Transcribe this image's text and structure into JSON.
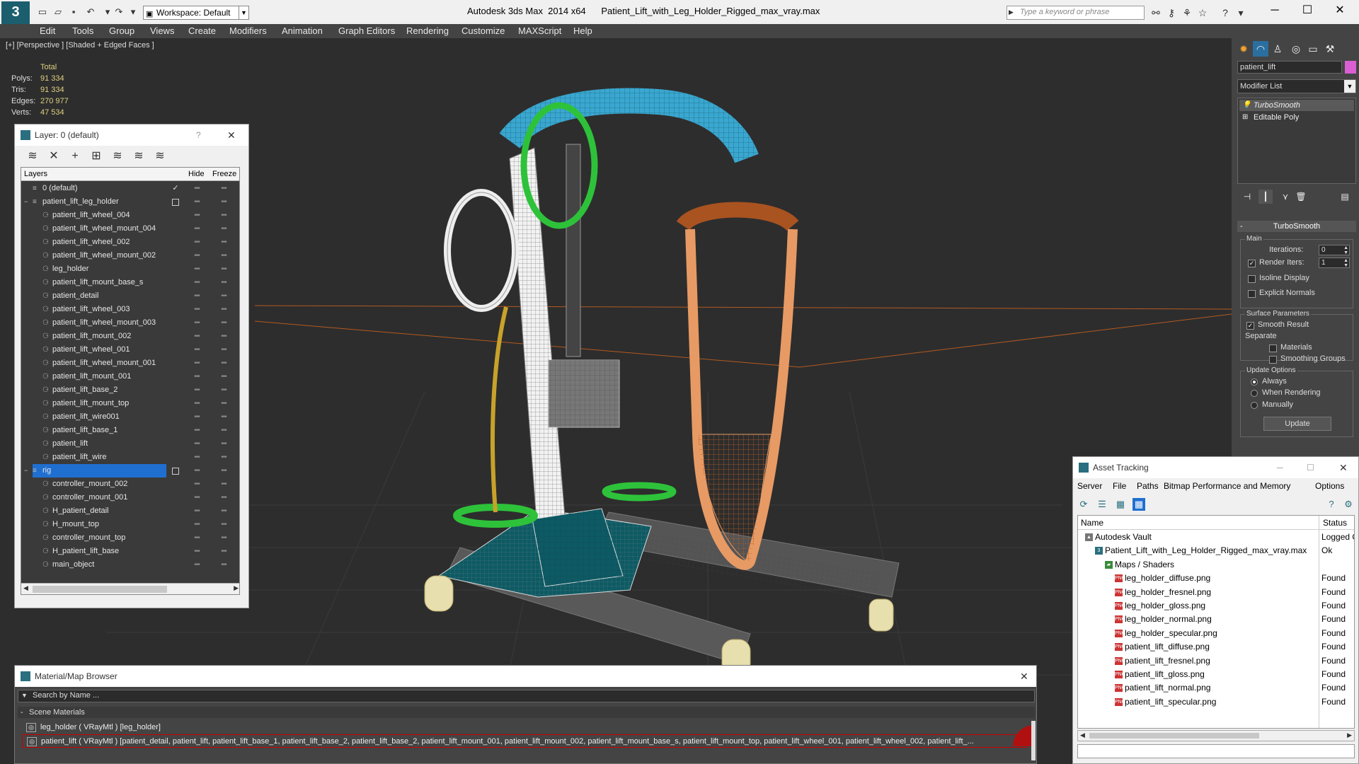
{
  "app": {
    "name_version": "Autodesk 3ds Max  2014 x64",
    "file": "Patient_Lift_with_Leg_Holder_Rigged_max_vray.max",
    "workspace": "Workspace: Default",
    "search_placeholder": "Type a keyword or phrase",
    "logo_letter": "3"
  },
  "menu": [
    "Edit",
    "Tools",
    "Group",
    "Views",
    "Create",
    "Modifiers",
    "Animation",
    "Graph Editors",
    "Rendering",
    "Customize",
    "MAXScript",
    "Help"
  ],
  "viewport": {
    "label": "[+] [Perspective ] [Shaded + Edged Faces ]",
    "stats": {
      "header": "Total",
      "rows": [
        {
          "k": "Polys:",
          "v": "91 334"
        },
        {
          "k": "Tris:",
          "v": "91 334"
        },
        {
          "k": "Edges:",
          "v": "270 977"
        },
        {
          "k": "Verts:",
          "v": "47 534"
        }
      ]
    }
  },
  "layer_panel": {
    "title": "Layer: 0 (default)",
    "help": "?",
    "close": "✕",
    "col_layers": "Layers",
    "col_hide": "Hide",
    "col_freeze": "Freeze",
    "rows": [
      {
        "name": "0 (default)",
        "level": 0,
        "type": "layer",
        "checked": true
      },
      {
        "name": "patient_lift_leg_holder",
        "level": 0,
        "type": "layer",
        "expand": "−",
        "box": true
      },
      {
        "name": "patient_lift_wheel_004",
        "level": 1,
        "type": "obj"
      },
      {
        "name": "patient_lift_wheel_mount_004",
        "level": 1,
        "type": "obj"
      },
      {
        "name": "patient_lift_wheel_002",
        "level": 1,
        "type": "obj"
      },
      {
        "name": "patient_lift_wheel_mount_002",
        "level": 1,
        "type": "obj"
      },
      {
        "name": "leg_holder",
        "level": 1,
        "type": "obj"
      },
      {
        "name": "patient_lift_mount_base_s",
        "level": 1,
        "type": "obj"
      },
      {
        "name": "patient_detail",
        "level": 1,
        "type": "obj"
      },
      {
        "name": "patient_lift_wheel_003",
        "level": 1,
        "type": "obj"
      },
      {
        "name": "patient_lift_wheel_mount_003",
        "level": 1,
        "type": "obj"
      },
      {
        "name": "patient_lift_mount_002",
        "level": 1,
        "type": "obj"
      },
      {
        "name": "patient_lift_wheel_001",
        "level": 1,
        "type": "obj"
      },
      {
        "name": "patient_lift_wheel_mount_001",
        "level": 1,
        "type": "obj"
      },
      {
        "name": "patient_lift_mount_001",
        "level": 1,
        "type": "obj"
      },
      {
        "name": "patient_lift_base_2",
        "level": 1,
        "type": "obj"
      },
      {
        "name": "patient_lift_mount_top",
        "level": 1,
        "type": "obj"
      },
      {
        "name": "patient_lift_wire001",
        "level": 1,
        "type": "obj"
      },
      {
        "name": "patient_lift_base_1",
        "level": 1,
        "type": "obj"
      },
      {
        "name": "patient_lift",
        "level": 1,
        "type": "obj"
      },
      {
        "name": "patient_lift_wire",
        "level": 1,
        "type": "obj"
      },
      {
        "name": "rig",
        "level": 0,
        "type": "layer",
        "expand": "−",
        "box": true,
        "selected": true
      },
      {
        "name": "controller_mount_002",
        "level": 1,
        "type": "obj"
      },
      {
        "name": "controller_mount_001",
        "level": 1,
        "type": "obj"
      },
      {
        "name": "H_patient_detail",
        "level": 1,
        "type": "obj"
      },
      {
        "name": "H_mount_top",
        "level": 1,
        "type": "obj"
      },
      {
        "name": "controller_mount_top",
        "level": 1,
        "type": "obj"
      },
      {
        "name": "H_patient_lift_base",
        "level": 1,
        "type": "obj"
      },
      {
        "name": "main_object",
        "level": 1,
        "type": "obj"
      }
    ]
  },
  "command_panel": {
    "object_name": "patient_lift",
    "object_color": "#d95fd2",
    "modifier_list": "Modifier List",
    "stack": [
      "TurboSmooth",
      "Editable Poly"
    ],
    "turbosmooth": {
      "title": "TurboSmooth",
      "main": "Main",
      "iterations_label": "Iterations:",
      "iterations": "0",
      "render_iters_label": "Render Iters:",
      "render_iters": "1",
      "isoline": "Isoline Display",
      "explicit_normals": "Explicit Normals",
      "surface_params": "Surface Parameters",
      "smooth_result": "Smooth Result",
      "separate": "Separate",
      "materials": "Materials",
      "smoothing_groups": "Smoothing Groups",
      "update_options": "Update Options",
      "always": "Always",
      "when_rendering": "When Rendering",
      "manually": "Manually",
      "update_btn": "Update"
    }
  },
  "asset_tracking": {
    "title": "Asset Tracking",
    "menu": [
      "Server",
      "File",
      "Paths",
      "Bitmap Performance and Memory",
      "Options"
    ],
    "col_name": "Name",
    "col_status": "Status",
    "rows": [
      {
        "name": "Autodesk Vault",
        "status": "Logged O",
        "level": 0,
        "icon": "vault"
      },
      {
        "name": "Patient_Lift_with_Leg_Holder_Rigged_max_vray.max",
        "status": "Ok",
        "level": 1,
        "icon": "max"
      },
      {
        "name": "Maps / Shaders",
        "status": "",
        "level": 2,
        "icon": "folder"
      },
      {
        "name": "leg_holder_diffuse.png",
        "status": "Found",
        "level": 3,
        "icon": "png"
      },
      {
        "name": "leg_holder_fresnel.png",
        "status": "Found",
        "level": 3,
        "icon": "png"
      },
      {
        "name": "leg_holder_gloss.png",
        "status": "Found",
        "level": 3,
        "icon": "png"
      },
      {
        "name": "leg_holder_normal.png",
        "status": "Found",
        "level": 3,
        "icon": "png"
      },
      {
        "name": "leg_holder_specular.png",
        "status": "Found",
        "level": 3,
        "icon": "png"
      },
      {
        "name": "patient_lift_diffuse.png",
        "status": "Found",
        "level": 3,
        "icon": "png"
      },
      {
        "name": "patient_lift_fresnel.png",
        "status": "Found",
        "level": 3,
        "icon": "png"
      },
      {
        "name": "patient_lift_gloss.png",
        "status": "Found",
        "level": 3,
        "icon": "png"
      },
      {
        "name": "patient_lift_normal.png",
        "status": "Found",
        "level": 3,
        "icon": "png"
      },
      {
        "name": "patient_lift_specular.png",
        "status": "Found",
        "level": 3,
        "icon": "png"
      }
    ]
  },
  "material_browser": {
    "title": "Material/Map Browser",
    "search_placeholder": "Search by Name ...",
    "group": "Scene Materials",
    "rows": [
      "leg_holder  ( VRayMtl ) [leg_holder]",
      "patient_lift ( VRayMtl ) [patient_detail, patient_lift, patient_lift_base_1, patient_lift_base_2, patient_lift_base_2, patient_lift_mount_001, patient_lift_mount_002, patient_lift_mount_base_s, patient_lift_mount_top, patient_lift_wheel_001, patient_lift_wheel_002, patient_lift_..."
    ]
  },
  "colors": {
    "selection": "#1f6fd0",
    "teal_brand": "#2a6f7f",
    "stat_value": "#e0d080"
  }
}
